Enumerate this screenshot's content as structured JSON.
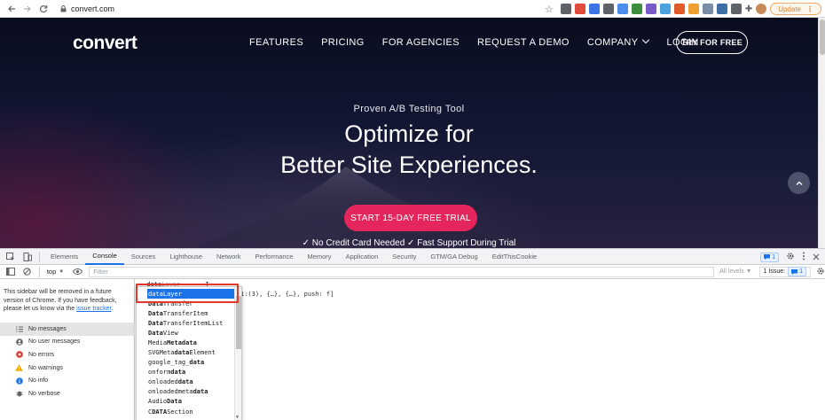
{
  "browser": {
    "url": "convert.com",
    "update_label": "Update",
    "extensions": [
      "#5f6368",
      "#e04b3c",
      "#3d73e8",
      "#5f6368",
      "#4a8dea",
      "#3c8f3c",
      "#7a5cc9",
      "#4aa3df",
      "#e05b2a",
      "#f0a030",
      "#7a8da6",
      "#3d6ea8",
      "#5f6368"
    ]
  },
  "site": {
    "logo": "convert",
    "nav": [
      {
        "label": "FEATURES"
      },
      {
        "label": "PRICING"
      },
      {
        "label": "FOR AGENCIES"
      },
      {
        "label": "REQUEST A DEMO"
      },
      {
        "label": "COMPANY",
        "dropdown": true
      },
      {
        "label": "LOGIN"
      }
    ],
    "try_label": "TRY FOR FREE",
    "tagline": "Proven A/B Testing Tool",
    "headline_1": "Optimize for",
    "headline_2": "Better Site Experiences.",
    "cta_label": "START 15-DAY FREE TRIAL",
    "benefits": "✓ No Credit Card Needed  ✓ Fast Support During Trial",
    "colors": {
      "cta": "#e5265c",
      "background": "#111632"
    }
  },
  "devtools": {
    "tabs": [
      "Elements",
      "Console",
      "Sources",
      "Lighthouse",
      "Network",
      "Performance",
      "Memory",
      "Application",
      "Security",
      "GTM/GA Debug",
      "EditThisCookie"
    ],
    "active_tab": "Console",
    "message_count": "1",
    "context": "top",
    "filter_placeholder": "Filter",
    "levels_label": "All levels ▼",
    "issues_label": "1 Issue:",
    "issues_count": "1",
    "sidebar_notice": "This sidebar will be removed in a future version of Chrome. If you have feedback, please let us know via the ",
    "sidebar_link": "issue tracker",
    "sidebar_notice_end": ".",
    "sidebar_items": [
      {
        "label": "No messages",
        "icon": "list-icon"
      },
      {
        "label": "No user messages",
        "icon": "user-icon"
      },
      {
        "label": "No errors",
        "icon": "error-icon"
      },
      {
        "label": "No warnings",
        "icon": "warning-icon"
      },
      {
        "label": "No info",
        "icon": "info-icon"
      },
      {
        "label": "No verbose",
        "icon": "bug-icon"
      }
    ],
    "console_input": "data",
    "console_ghost": "Layer",
    "console_result": "1:(3), {…}, {…}, push: f]",
    "autocomplete_selected": "dataLayer",
    "autocomplete": [
      {
        "pre": "",
        "match": "Data",
        "post": "Transfer"
      },
      {
        "pre": "",
        "match": "Data",
        "post": "TransferItem"
      },
      {
        "pre": "",
        "match": "Data",
        "post": "TransferItemList"
      },
      {
        "pre": "",
        "match": "Data",
        "post": "View"
      },
      {
        "pre": "Media",
        "match": "Metadata",
        "post": ""
      },
      {
        "pre": "SVGMeta",
        "match": "data",
        "post": "Element"
      },
      {
        "pre": "google_tag_",
        "match": "data",
        "post": ""
      },
      {
        "pre": "onform",
        "match": "data",
        "post": ""
      },
      {
        "pre": "onloaded",
        "match": "data",
        "post": ""
      },
      {
        "pre": "onloadedmeta",
        "match": "data",
        "post": ""
      },
      {
        "pre": "Audio",
        "match": "Data",
        "post": ""
      },
      {
        "pre": "C",
        "match": "DATA",
        "post": "Section"
      }
    ]
  }
}
